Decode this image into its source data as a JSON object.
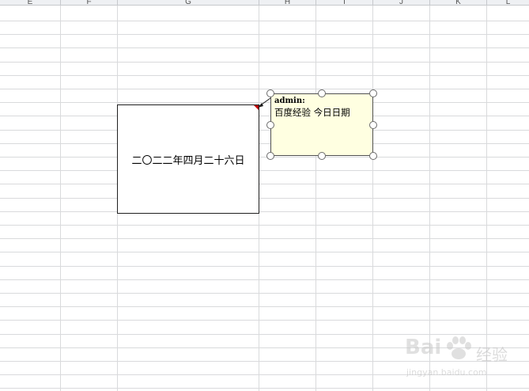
{
  "column_headers": [
    "E",
    "F",
    "G",
    "H",
    "I",
    "J",
    "K",
    "L"
  ],
  "merged_cell": {
    "text": "二〇二二年四月二十六日"
  },
  "comment": {
    "author": "admin:",
    "text": "百度经验 今日日期"
  },
  "watermark": {
    "brand": "Bai",
    "suffix": "经验",
    "domain": "jingyan.baidu.com"
  },
  "colors": {
    "comment_fill": "#ffffe1",
    "indicator": "#c00000",
    "grid": "#d9dadc"
  }
}
